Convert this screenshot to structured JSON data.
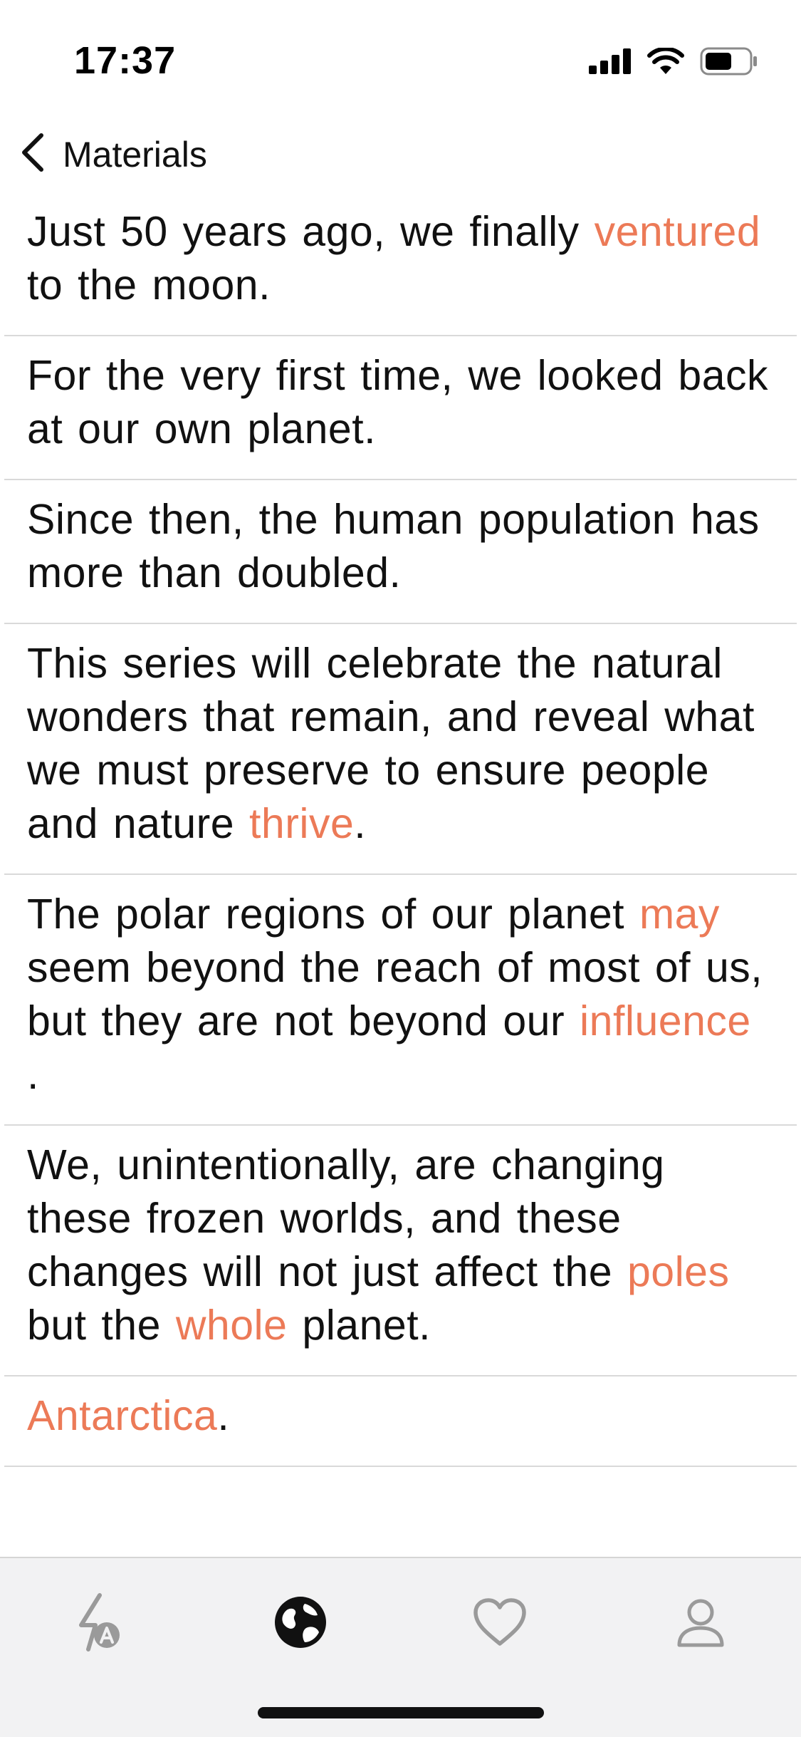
{
  "status_bar": {
    "time": "17:37",
    "icons": [
      "cellular-signal-icon",
      "wifi-icon",
      "battery-icon"
    ]
  },
  "nav": {
    "back_icon": "chevron-left-icon",
    "back_label": "Materials"
  },
  "colors": {
    "highlight": "#ec7a57",
    "text": "#111111",
    "divider": "#d9d9d9",
    "tab_bar_bg": "#f2f2f3",
    "tab_inactive": "#9a9a9a",
    "tab_active": "#111111"
  },
  "sentences": [
    {
      "parts": [
        {
          "text": "Just 50 years ago, we finally ",
          "highlight": false
        },
        {
          "text": "ventured",
          "highlight": true
        },
        {
          "text": " to the moon.",
          "highlight": false
        }
      ]
    },
    {
      "parts": [
        {
          "text": "For the very first time, we looked back at our own planet.",
          "highlight": false
        }
      ]
    },
    {
      "parts": [
        {
          "text": "Since then, the human population has more than doubled.",
          "highlight": false
        }
      ]
    },
    {
      "parts": [
        {
          "text": "This series will celebrate the natural wonders that remain, and reveal what we must preserve to ensure people and nature ",
          "highlight": false
        },
        {
          "text": "thrive",
          "highlight": true
        },
        {
          "text": ".",
          "highlight": false
        }
      ]
    },
    {
      "parts": [
        {
          "text": "The polar regions of our planet ",
          "highlight": false
        },
        {
          "text": "may",
          "highlight": true
        },
        {
          "text": " seem beyond the reach of most of us, but they are not beyond our ",
          "highlight": false
        },
        {
          "text": "influence",
          "highlight": true
        },
        {
          "text": " .",
          "highlight": false
        }
      ]
    },
    {
      "parts": [
        {
          "text": "We, unintentionally, are changing these frozen worlds, and these changes will not just affect the ",
          "highlight": false
        },
        {
          "text": "poles",
          "highlight": true
        },
        {
          "text": " but the ",
          "highlight": false
        },
        {
          "text": "whole",
          "highlight": true
        },
        {
          "text": " planet.",
          "highlight": false
        }
      ]
    },
    {
      "parts": [
        {
          "text": "Antarctica",
          "highlight": true
        },
        {
          "text": ".",
          "highlight": false
        }
      ]
    }
  ],
  "tab_bar": {
    "tabs": [
      {
        "icon": "lightning-a-icon",
        "active": false
      },
      {
        "icon": "globe-icon",
        "active": true
      },
      {
        "icon": "heart-icon",
        "active": false
      },
      {
        "icon": "person-icon",
        "active": false
      }
    ]
  }
}
